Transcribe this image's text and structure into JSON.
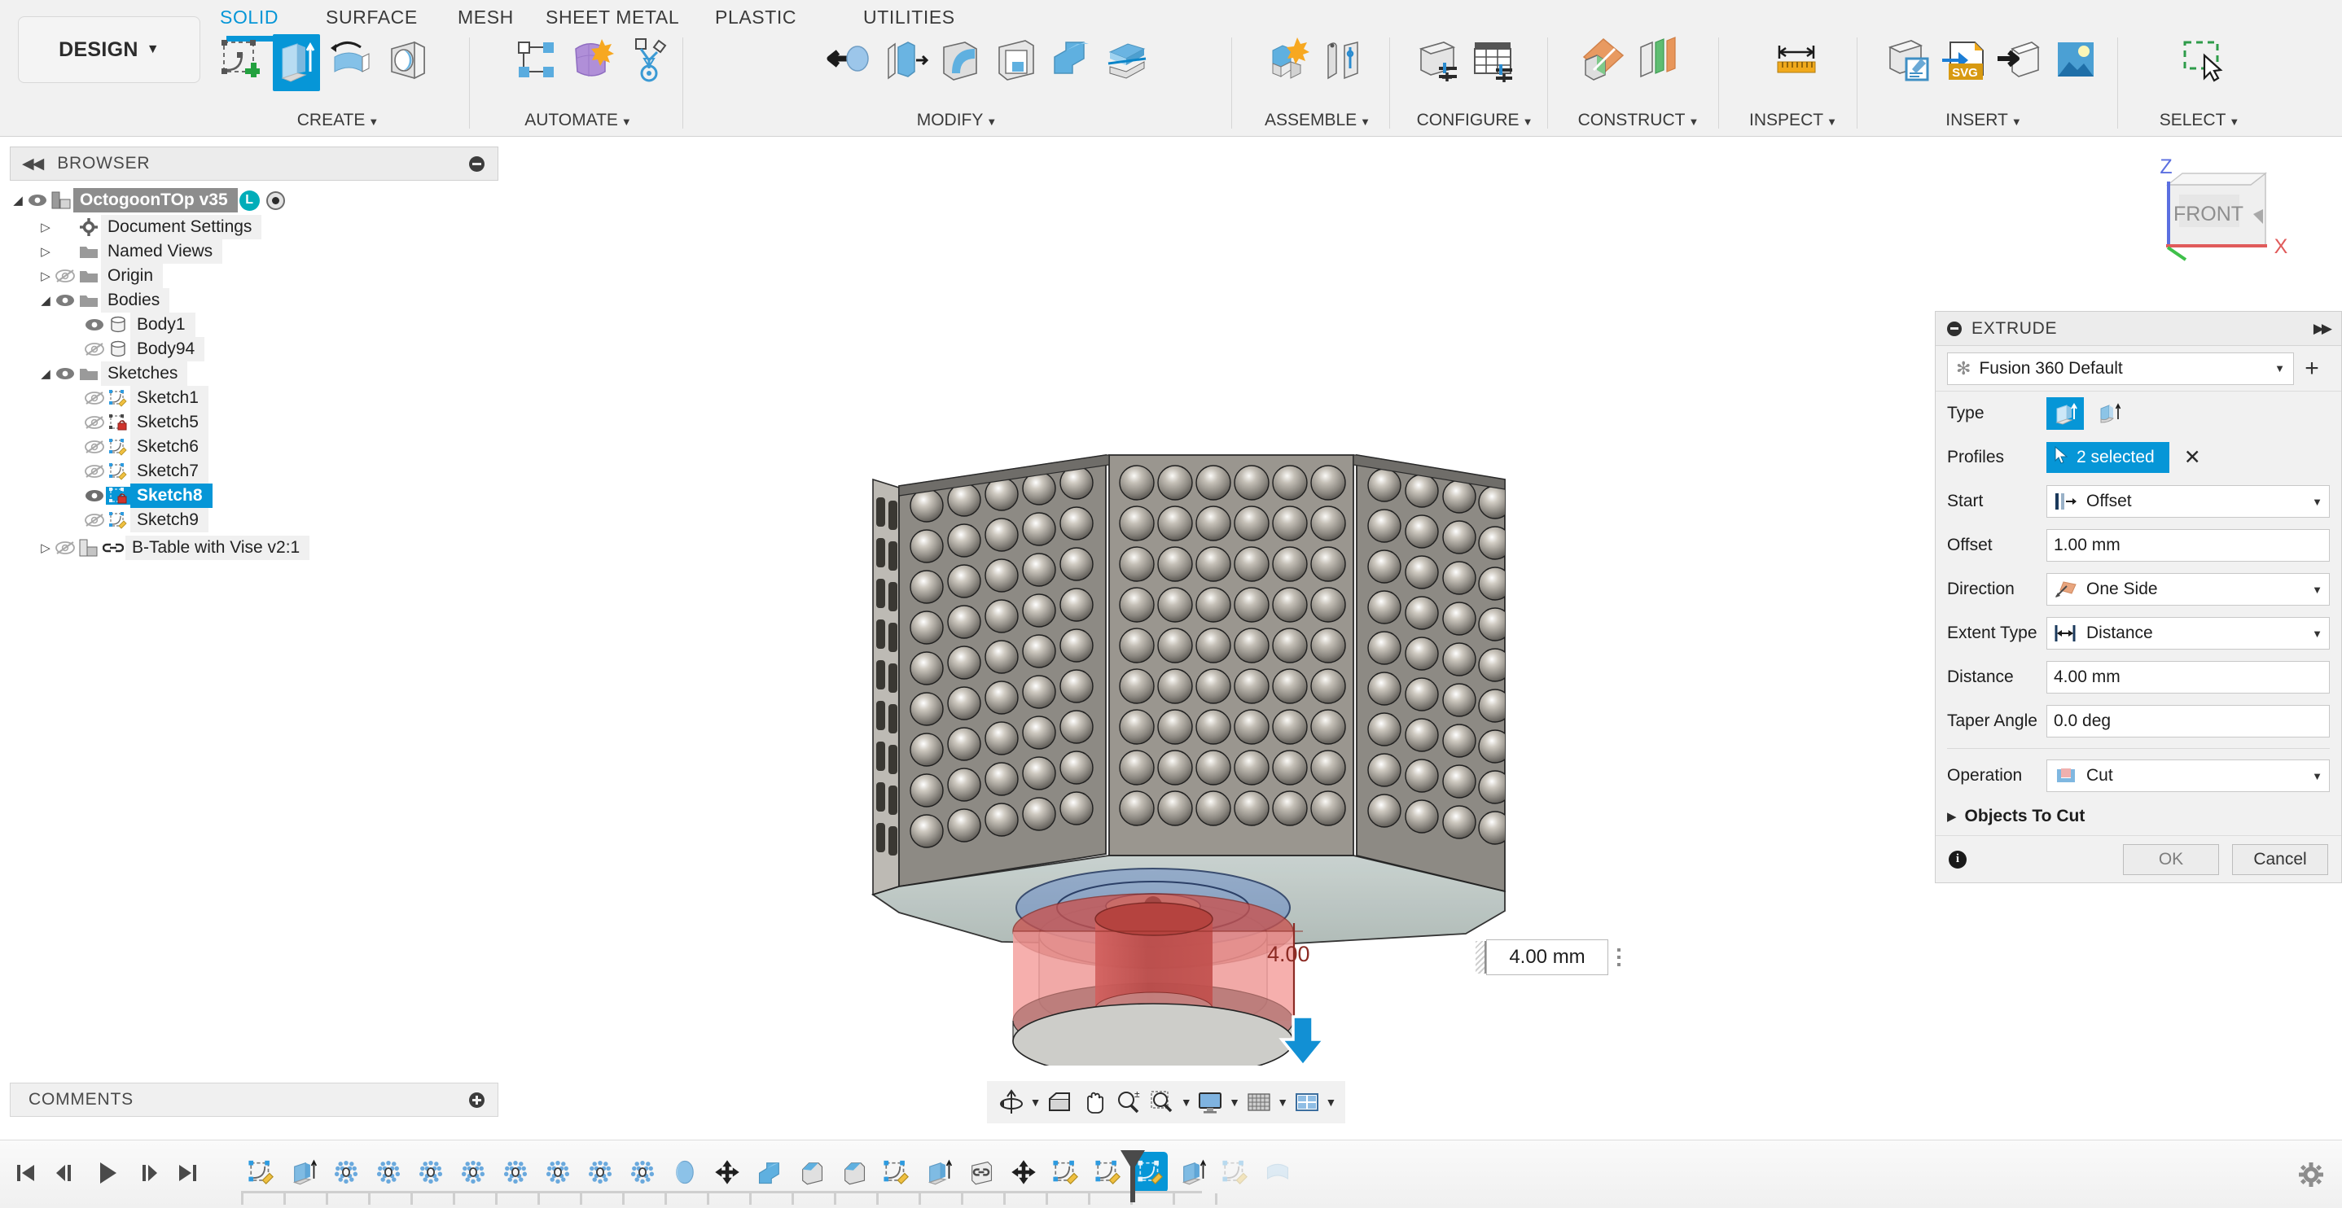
{
  "app": {
    "workspace_button": "DESIGN",
    "tabs": [
      {
        "label": "SOLID",
        "active": true
      },
      {
        "label": "SURFACE",
        "active": false
      },
      {
        "label": "MESH",
        "active": false
      },
      {
        "label": "SHEET METAL",
        "active": false
      },
      {
        "label": "PLASTIC",
        "active": false
      },
      {
        "label": "UTILITIES",
        "active": false
      }
    ],
    "ribbon_groups": [
      {
        "label": "CREATE",
        "icons": [
          "create-sketch-icon",
          "extrude-icon",
          "revolve-icon",
          "sweep-icon"
        ]
      },
      {
        "label": "AUTOMATE",
        "icons": [
          "automate-shape-icon",
          "automate-purple-icon",
          "automate-generative-icon"
        ]
      },
      {
        "label": "MODIFY",
        "icons": [
          "press-pull-icon",
          "offset-face-icon",
          "fillet-icon",
          "shell-icon",
          "combine-icon",
          "split-body-icon"
        ]
      },
      {
        "label": "ASSEMBLE",
        "icons": [
          "new-component-icon",
          "joint-icon"
        ]
      },
      {
        "label": "CONFIGURE",
        "icons": [
          "configure-body-icon",
          "configure-table-icon"
        ]
      },
      {
        "label": "CONSTRUCT",
        "icons": [
          "offset-plane-icon",
          "plane-at-angle-icon"
        ]
      },
      {
        "label": "INSPECT",
        "icons": [
          "measure-icon"
        ]
      },
      {
        "label": "INSERT",
        "icons": [
          "insert-decal-icon",
          "insert-svg-icon",
          "insert-mesh-icon",
          "insert-canvas-icon"
        ]
      },
      {
        "label": "SELECT",
        "icons": [
          "select-window-icon"
        ]
      }
    ]
  },
  "browser": {
    "title": "BROWSER",
    "collapse_icon": "collapse-left-icon",
    "minimize_icon": "minus-circle-icon",
    "tree": [
      {
        "label": "OctogoonTOp v35",
        "indent": 0,
        "arrow": "expanded",
        "eye": "visible",
        "icon": "component-icon",
        "badge": "L",
        "radio": true,
        "selected_doc": true
      },
      {
        "label": "Document Settings",
        "indent": 1,
        "arrow": "collapsed",
        "eye": "none",
        "icon": "gear-icon"
      },
      {
        "label": "Named Views",
        "indent": 1,
        "arrow": "collapsed",
        "eye": "none",
        "icon": "folder-icon"
      },
      {
        "label": "Origin",
        "indent": 1,
        "arrow": "collapsed",
        "eye": "hidden",
        "icon": "folder-icon"
      },
      {
        "label": "Bodies",
        "indent": 1,
        "arrow": "expanded",
        "eye": "visible",
        "icon": "folder-icon"
      },
      {
        "label": "Body1",
        "indent": 2,
        "arrow": "none",
        "eye": "visible",
        "icon": "body-icon"
      },
      {
        "label": "Body94",
        "indent": 2,
        "arrow": "none",
        "eye": "hidden",
        "icon": "body-icon"
      },
      {
        "label": "Sketches",
        "indent": 1,
        "arrow": "expanded",
        "eye": "visible",
        "icon": "folder-icon"
      },
      {
        "label": "Sketch1",
        "indent": 2,
        "arrow": "none",
        "eye": "hidden",
        "icon": "sketch-icon"
      },
      {
        "label": "Sketch5",
        "indent": 2,
        "arrow": "none",
        "eye": "hidden",
        "icon": "sketch-locked-icon"
      },
      {
        "label": "Sketch6",
        "indent": 2,
        "arrow": "none",
        "eye": "hidden",
        "icon": "sketch-icon"
      },
      {
        "label": "Sketch7",
        "indent": 2,
        "arrow": "none",
        "eye": "hidden",
        "icon": "sketch-icon"
      },
      {
        "label": "Sketch8",
        "indent": 2,
        "arrow": "none",
        "eye": "visible",
        "icon": "sketch-locked-icon",
        "selected": true
      },
      {
        "label": "Sketch9",
        "indent": 2,
        "arrow": "none",
        "eye": "hidden",
        "icon": "sketch-icon"
      },
      {
        "label": "B-Table with Vise v2:1",
        "indent": 1,
        "arrow": "collapsed",
        "eye": "hidden",
        "icon": "component-icon",
        "link": true
      }
    ]
  },
  "comments": {
    "title": "COMMENTS",
    "add_icon": "plus-circle-icon"
  },
  "viewport": {
    "viewcube_face": "FRONT",
    "axis_z": "Z",
    "axis_x": "X",
    "dimension_label": "4.00",
    "dim_input_value": "4.00 mm",
    "manipulator_arrow": "down-arrow-handle",
    "navbar": [
      {
        "name": "orbit-icon",
        "caret": true
      },
      {
        "name": "look-at-icon",
        "caret": false
      },
      {
        "name": "pan-icon",
        "caret": false
      },
      {
        "name": "zoom-icon",
        "caret": false
      },
      {
        "name": "zoom-window-icon",
        "caret": true
      },
      {
        "name": "display-settings-icon",
        "caret": true
      },
      {
        "name": "grid-snap-icon",
        "caret": true
      },
      {
        "name": "viewports-icon",
        "caret": true
      }
    ]
  },
  "extrude_panel": {
    "title": "EXTRUDE",
    "expand_icon": "expand-right-icon",
    "preset": {
      "value": "Fusion 360 Default",
      "star_icon": "star-icon",
      "add_icon": "plus-icon"
    },
    "fields": {
      "type_label": "Type",
      "type_options": [
        "extrude-profile-icon",
        "extrude-thin-icon"
      ],
      "type_selected_index": 0,
      "profiles_label": "Profiles",
      "profiles_value": "2 selected",
      "profiles_clear_icon": "close-x-icon",
      "start_label": "Start",
      "start_value": "Offset",
      "offset_label": "Offset",
      "offset_value": "1.00 mm",
      "direction_label": "Direction",
      "direction_value": "One Side",
      "extent_type_label": "Extent Type",
      "extent_type_value": "Distance",
      "distance_label": "Distance",
      "distance_value": "4.00 mm",
      "taper_angle_label": "Taper Angle",
      "taper_angle_value": "0.0 deg",
      "operation_label": "Operation",
      "operation_value": "Cut",
      "objects_to_cut_label": "Objects To Cut"
    },
    "footer": {
      "info_icon": "info-icon",
      "ok_label": "OK",
      "cancel_label": "Cancel"
    }
  },
  "timeline": {
    "playback": [
      "go-to-start-icon",
      "step-back-icon",
      "play-icon",
      "step-forward-icon",
      "go-to-end-icon"
    ],
    "features": [
      {
        "icon": "sketch-icon"
      },
      {
        "icon": "extrude-icon"
      },
      {
        "icon": "pattern-icon"
      },
      {
        "icon": "pattern-icon"
      },
      {
        "icon": "pattern-icon"
      },
      {
        "icon": "pattern-icon"
      },
      {
        "icon": "pattern-icon"
      },
      {
        "icon": "pattern-icon"
      },
      {
        "icon": "pattern-icon"
      },
      {
        "icon": "pattern-icon"
      },
      {
        "icon": "revolve-icon"
      },
      {
        "icon": "move-icon"
      },
      {
        "icon": "combine-icon"
      },
      {
        "icon": "chamfer-icon"
      },
      {
        "icon": "chamfer-icon"
      },
      {
        "icon": "sketch-icon"
      },
      {
        "icon": "extrude-icon"
      },
      {
        "icon": "link-icon"
      },
      {
        "icon": "move-icon"
      },
      {
        "icon": "sketch-icon"
      },
      {
        "icon": "sketch-icon"
      },
      {
        "icon": "sketch-icon",
        "current": true
      },
      {
        "icon": "extrude-icon"
      },
      {
        "icon": "sketch-icon",
        "ghost": true
      },
      {
        "icon": "revolve-icon",
        "ghost": true
      }
    ],
    "settings_icon": "gear-icon"
  },
  "colors": {
    "accent": "#0696d7",
    "teal_badge": "#00adb9",
    "highlight_red": "#e8888a",
    "dimension_text": "#8c2b24",
    "ribbon_bg": "#f1f1f1"
  }
}
